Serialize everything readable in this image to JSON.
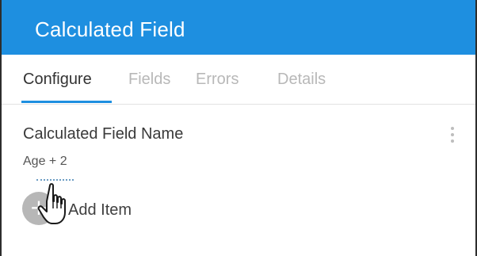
{
  "dialog": {
    "title": "Calculated Field"
  },
  "tabs": [
    {
      "label": "Configure",
      "active": true
    },
    {
      "label": "Fields",
      "active": false
    },
    {
      "label": "Errors",
      "active": false
    },
    {
      "label": "Details",
      "active": false
    }
  ],
  "field": {
    "name_label": "Calculated Field Name",
    "value": "Age + 2"
  },
  "add_item": {
    "label": "Add Item",
    "icon": "plus-icon"
  },
  "menu_icon": "more-vertical-icon",
  "cursor_icon": "hand-pointer-icon",
  "colors": {
    "accent": "#1e8fe0",
    "tab_inactive": "#b8b8b8",
    "add_circle": "#b7b7b7"
  }
}
